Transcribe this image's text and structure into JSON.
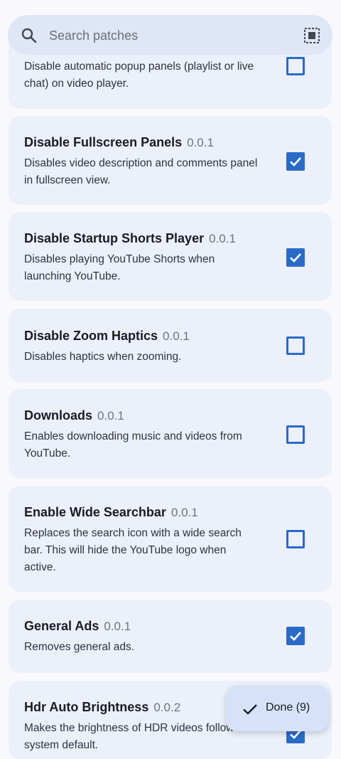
{
  "search": {
    "placeholder": "Search patches"
  },
  "patches": [
    {
      "name": "",
      "version": "",
      "description": "Disable automatic popup panels (playlist or live chat) on video player.",
      "checked": false
    },
    {
      "name": "Disable Fullscreen Panels",
      "version": "0.0.1",
      "description": "Disables video description and comments panel in fullscreen view.",
      "checked": true
    },
    {
      "name": "Disable Startup Shorts Player",
      "version": "0.0.1",
      "description": "Disables playing YouTube Shorts when launching YouTube.",
      "checked": true
    },
    {
      "name": "Disable Zoom Haptics",
      "version": "0.0.1",
      "description": "Disables haptics when zooming.",
      "checked": false
    },
    {
      "name": "Downloads",
      "version": "0.0.1",
      "description": "Enables downloading music and videos from YouTube.",
      "checked": false
    },
    {
      "name": "Enable Wide Searchbar",
      "version": "0.0.1",
      "description": "Replaces the search icon with a wide search bar. This will hide the YouTube logo when active.",
      "checked": false
    },
    {
      "name": "General Ads",
      "version": "0.0.1",
      "description": "Removes general ads.",
      "checked": true
    },
    {
      "name": "Hdr Auto Brightness",
      "version": "0.0.2",
      "description": "Makes the brightness of HDR videos follow the system default.",
      "checked": true
    }
  ],
  "done_button": {
    "label": "Done (9)"
  },
  "colors": {
    "accent": "#2a6bc7",
    "card": "#ebf0fa",
    "background": "#f9f9fd",
    "search_bg": "#dfe6f5",
    "fab_bg": "#d5e2f7"
  }
}
